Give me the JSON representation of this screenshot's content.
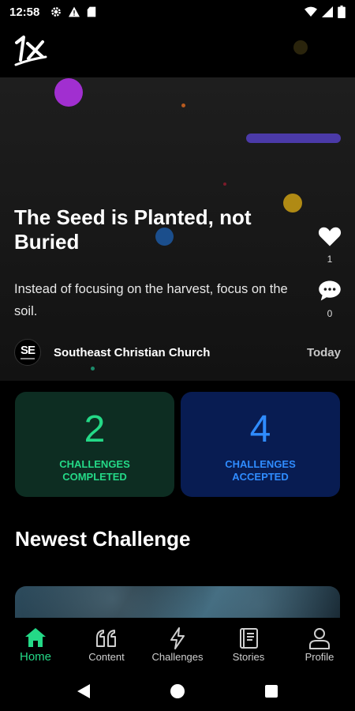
{
  "status_bar": {
    "time": "12:58",
    "left_icons": [
      "gear-icon",
      "alert-icon",
      "sd-card-icon"
    ],
    "right_icons": [
      "wifi-icon",
      "signal-icon",
      "battery-icon"
    ]
  },
  "app": {
    "logo_text": "1X"
  },
  "hero": {
    "title": "The Seed is Planted, not Buried",
    "description": "Instead of focusing on the harvest, focus on the soil.",
    "likes": "1",
    "comments": "0",
    "church_avatar": "SE",
    "church_name": "Southeast Christian Church",
    "date": "Today"
  },
  "stats": {
    "completed": {
      "value": "2",
      "label": "CHALLENGES COMPLETED",
      "color": "#24d987"
    },
    "accepted": {
      "value": "4",
      "label": "CHALLENGES ACCEPTED",
      "color": "#2f8cff"
    }
  },
  "section": {
    "title": "Newest Challenge"
  },
  "nav": {
    "items": [
      {
        "label": "Home",
        "icon": "home-icon",
        "active": true
      },
      {
        "label": "Content",
        "icon": "quote-icon",
        "active": false
      },
      {
        "label": "Challenges",
        "icon": "lightning-icon",
        "active": false
      },
      {
        "label": "Stories",
        "icon": "book-icon",
        "active": false
      },
      {
        "label": "Profile",
        "icon": "person-icon",
        "active": false
      }
    ],
    "accent": "#24d987"
  },
  "system_nav": [
    "back-icon",
    "home-circle-icon",
    "recents-icon"
  ]
}
